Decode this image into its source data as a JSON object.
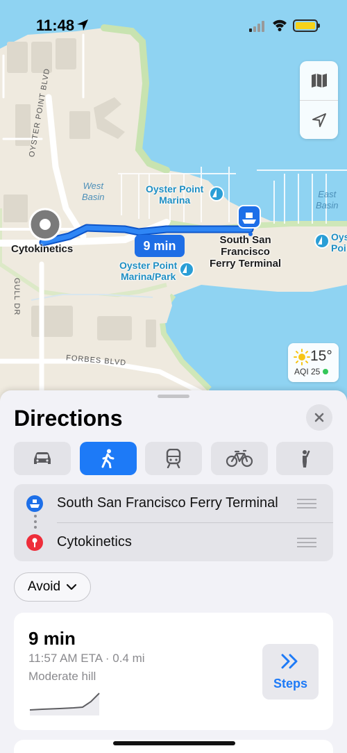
{
  "status_bar": {
    "time": "11:48"
  },
  "map": {
    "labels": {
      "oyster_point_blvd": "OYSTER POINT BLVD",
      "gull_dr": "GULL DR",
      "forbes_blvd": "FORBES BLVD",
      "west_basin_1": "West",
      "west_basin_2": "Basin",
      "east_basin_1": "East",
      "east_basin_2": "Basin",
      "oyster_point_marina_1": "Oyster Point",
      "oyster_point_marina_2": "Marina",
      "oyster_point_marina_park_1": "Oyster Point",
      "oyster_point_marina_park_2": "Marina/Park",
      "oyster_point_edge": "Oys",
      "oyster_point_edge_2": "Poi",
      "origin": "Cytokinetics",
      "ferry_1": "South San",
      "ferry_2": "Francisco",
      "ferry_3": "Ferry Terminal"
    },
    "eta_bubble": "9 min",
    "weather": {
      "temp": "15°",
      "aqi": "AQI 25"
    },
    "colors": {
      "water": "#8fd3f2",
      "land": "#efeadf",
      "park": "#cfe7b8",
      "route": "#1d6fe8"
    }
  },
  "directions": {
    "title": "Directions",
    "modes": [
      {
        "name": "drive",
        "icon": "car-icon",
        "active": false
      },
      {
        "name": "walk",
        "icon": "walk-icon",
        "active": true
      },
      {
        "name": "transit",
        "icon": "train-icon",
        "active": false
      },
      {
        "name": "cycle",
        "icon": "bicycle-icon",
        "active": false
      },
      {
        "name": "rideshare",
        "icon": "person-hail-icon",
        "active": false
      }
    ],
    "from": "South San Francisco Ferry Terminal",
    "to": "Cytokinetics",
    "avoid_label": "Avoid",
    "route": {
      "duration": "9 min",
      "eta_distance": "11:57 AM ETA · 0.4 mi",
      "terrain": "Moderate hill",
      "steps_label": "Steps"
    }
  }
}
